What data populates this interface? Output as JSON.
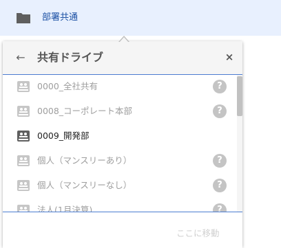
{
  "top": {
    "folder_label": "部署共通"
  },
  "dialog": {
    "title": "共有ドライブ",
    "back_glyph": "←",
    "close_glyph": "×",
    "items": [
      {
        "label": "0000_全社共有",
        "active": false,
        "help": "?"
      },
      {
        "label": "0008_コーポレート本部",
        "active": false,
        "help": "?"
      },
      {
        "label": "0009_開発部",
        "active": true,
        "help": ""
      },
      {
        "label": "個人（マンスリーあり）",
        "active": false,
        "help": "?"
      },
      {
        "label": "個人（マンスリーなし）",
        "active": false,
        "help": "?"
      },
      {
        "label": "法人(1月決算)",
        "active": false,
        "help": "?"
      }
    ],
    "move_label": "ここに移動"
  },
  "colors": {
    "top_bar_bg": "#e8f0fe",
    "link_blue": "#1a4fa3",
    "accent_line": "#4a7bd0",
    "help_icon": "#c4c4c4"
  }
}
